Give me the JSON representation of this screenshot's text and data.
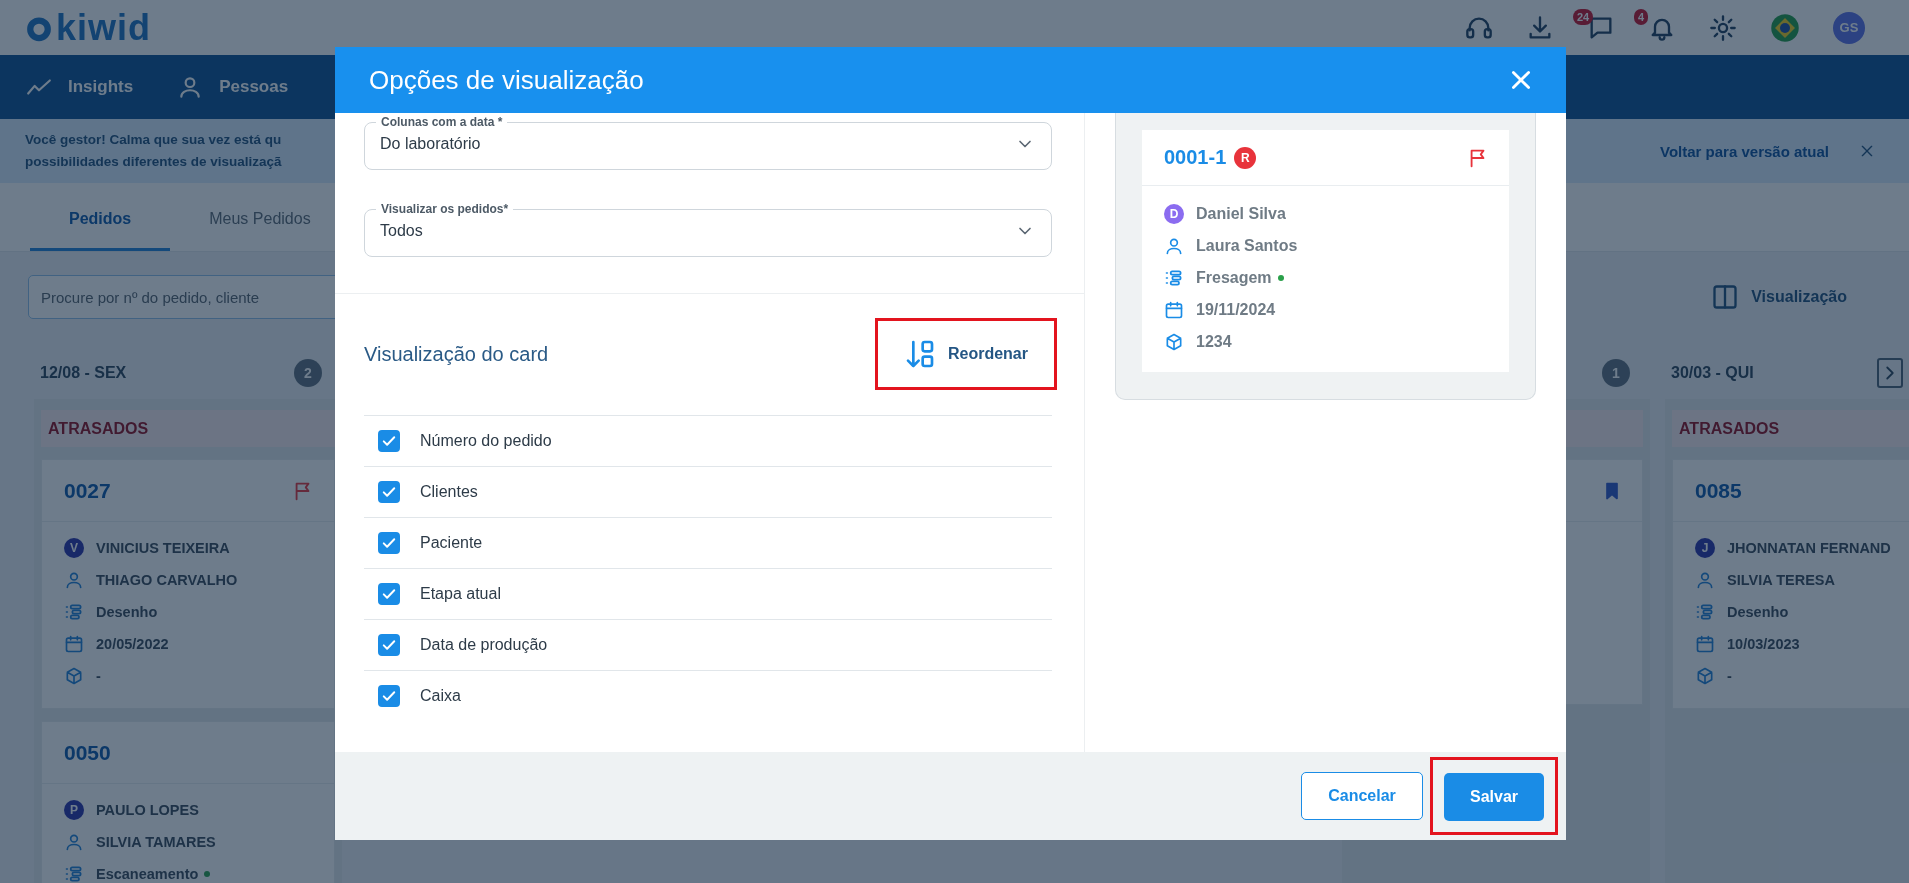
{
  "header": {
    "logo": "kiwid",
    "chat_badge": "24",
    "notification_badge": "4",
    "avatar": "GS"
  },
  "nav": [
    {
      "label": "Insights"
    },
    {
      "label": "Pessoas"
    }
  ],
  "banner": {
    "lines": [
      "Você gestor! Calma que sua vez está qu",
      "possibilidades diferentes de visualizaçã"
    ],
    "link": "Voltar para versão atual"
  },
  "tabs": [
    {
      "label": "Pedidos",
      "selected": true
    },
    {
      "label": "Meus Pedidos",
      "selected": false
    }
  ],
  "search": {
    "placeholder": "Procure por nº do pedido, cliente"
  },
  "view_button": "Visualização",
  "columns": [
    {
      "date": "12/08 - SEX",
      "count": "2",
      "section": "ATRASADOS",
      "cards": [
        {
          "number": "0027",
          "flagged": true,
          "bookmarked": false,
          "rows": [
            {
              "kind": "client",
              "initial": "V",
              "text": "VINICIUS TEIXEIRA"
            },
            {
              "kind": "patient",
              "text": "THIAGO CARVALHO"
            },
            {
              "kind": "stage",
              "text": "Desenho",
              "dot": false
            },
            {
              "kind": "date",
              "text": "20/05/2022"
            },
            {
              "kind": "box",
              "text": "-"
            }
          ]
        },
        {
          "number": "0050",
          "flagged": false,
          "bookmarked": false,
          "rows": [
            {
              "kind": "client",
              "initial": "P",
              "text": "PAULO LOPES"
            },
            {
              "kind": "patient",
              "text": "SILVIA TAMARES"
            },
            {
              "kind": "stage",
              "text": "Escaneamento",
              "dot": true
            }
          ]
        }
      ]
    },
    {
      "count": "1",
      "cards": [
        {
          "flagged": false,
          "bookmarked": true
        }
      ]
    },
    {
      "date": "30/03 - QUI",
      "section": "ATRASADOS",
      "cards": [
        {
          "number": "0085",
          "flagged": false,
          "bookmarked": false,
          "rows": [
            {
              "kind": "client",
              "initial": "J",
              "text": "JHONNATAN FERNAND"
            },
            {
              "kind": "patient",
              "text": "SILVIA TERESA"
            },
            {
              "kind": "stage",
              "text": "Desenho",
              "dot": false
            },
            {
              "kind": "date",
              "text": "10/03/2023"
            },
            {
              "kind": "box",
              "text": "-"
            }
          ]
        }
      ]
    }
  ],
  "dialog": {
    "title": "Opções de visualização",
    "fields": [
      {
        "label": "Colunas com a data *",
        "value": "Do laboratório"
      },
      {
        "label": "Visualizar os pedidos*",
        "value": "Todos"
      }
    ],
    "section_title": "Visualização do card",
    "reorder": {
      "label": "Reordenar",
      "highlighted": true
    },
    "options": [
      {
        "label": "Número do pedido",
        "checked": true
      },
      {
        "label": "Clientes",
        "checked": true
      },
      {
        "label": "Paciente",
        "checked": true
      },
      {
        "label": "Etapa atual",
        "checked": true
      },
      {
        "label": "Data de produção",
        "checked": true
      },
      {
        "label": "Caixa",
        "checked": true
      }
    ],
    "preview": {
      "number": "0001-1",
      "badge": "R",
      "flagged": true,
      "bookmarked": false,
      "rows": [
        {
          "kind": "client",
          "initial": "D",
          "text": "Daniel Silva"
        },
        {
          "kind": "patient",
          "text": "Laura Santos"
        },
        {
          "kind": "stage",
          "text": "Fresagem",
          "dot": true
        },
        {
          "kind": "date",
          "text": "19/11/2024"
        },
        {
          "kind": "box",
          "text": "1234"
        }
      ]
    },
    "buttons": [
      {
        "label": "Cancelar",
        "kind": "secondary",
        "highlighted": false
      },
      {
        "label": "Salvar",
        "kind": "primary",
        "highlighted": true
      }
    ]
  }
}
